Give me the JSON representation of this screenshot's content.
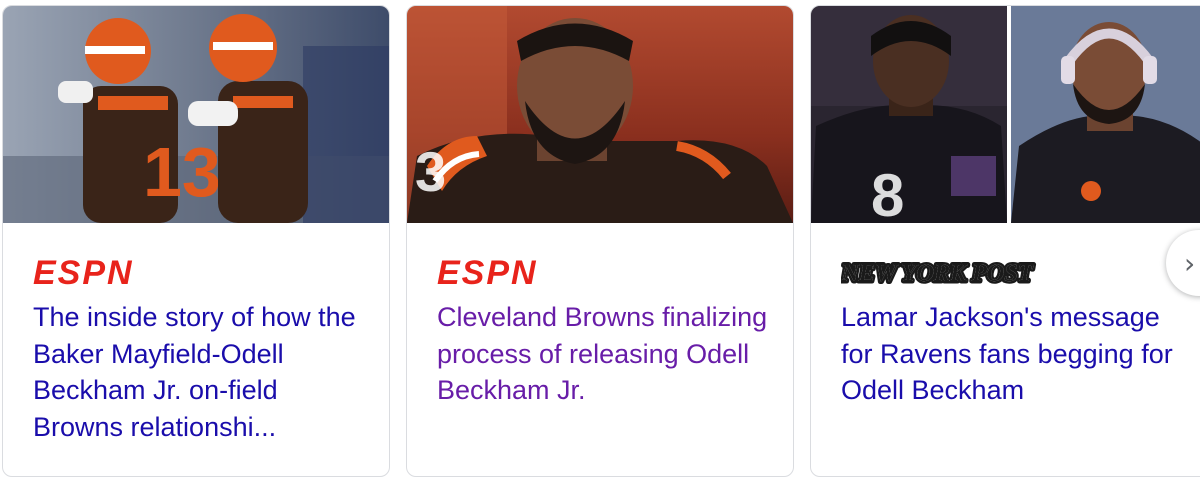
{
  "cards": [
    {
      "source": "ESPN",
      "headline": "The inside story of how the Baker Mayfield-Odell Beckham Jr. on-field Browns relationshi...",
      "visited": false,
      "accent": "#e8231b"
    },
    {
      "source": "ESPN",
      "headline": "Cleveland Browns finalizing process of releasing Odell Beckham Jr.",
      "visited": true,
      "accent": "#e8231b"
    },
    {
      "source": "NEW YORK POST",
      "headline": "Lamar Jackson's message for Ravens fans begging for Odell Beckham",
      "visited": false,
      "accent": "#1a1a1a"
    }
  ],
  "colors": {
    "link": "#1a0dab",
    "visited_link": "#681da8",
    "browns_orange": "#e05a1e",
    "browns_brown": "#3a2418"
  },
  "next_button": {
    "icon": "chevron-right-icon",
    "glyph": "›"
  }
}
